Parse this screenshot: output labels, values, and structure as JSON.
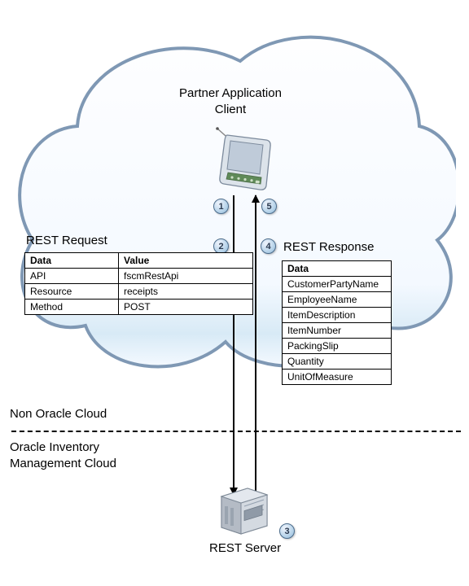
{
  "partner_label_l1": "Partner Application",
  "partner_label_l2": "Client",
  "markers": {
    "m1": "1",
    "m2": "2",
    "m3": "3",
    "m4": "4",
    "m5": "5"
  },
  "rest_request_title": "REST Request",
  "rest_response_title": "REST Response",
  "req_header": {
    "c1": "Data",
    "c2": "Value"
  },
  "req_rows": [
    {
      "c1": "API",
      "c2": "fscmRestApi"
    },
    {
      "c1": "Resource",
      "c2": "receipts"
    },
    {
      "c1": "Method",
      "c2": "POST"
    }
  ],
  "resp_header": "Data",
  "resp_rows": [
    "CustomerPartyName",
    "EmployeeName",
    "ItemDescription",
    "ItemNumber",
    "PackingSlip",
    "Quantity",
    "UnitOfMeasure"
  ],
  "cloud_caption": "Non Oracle Cloud",
  "lower_caption_l1": "Oracle Inventory",
  "lower_caption_l2": "Management Cloud",
  "server_label": "REST Server"
}
